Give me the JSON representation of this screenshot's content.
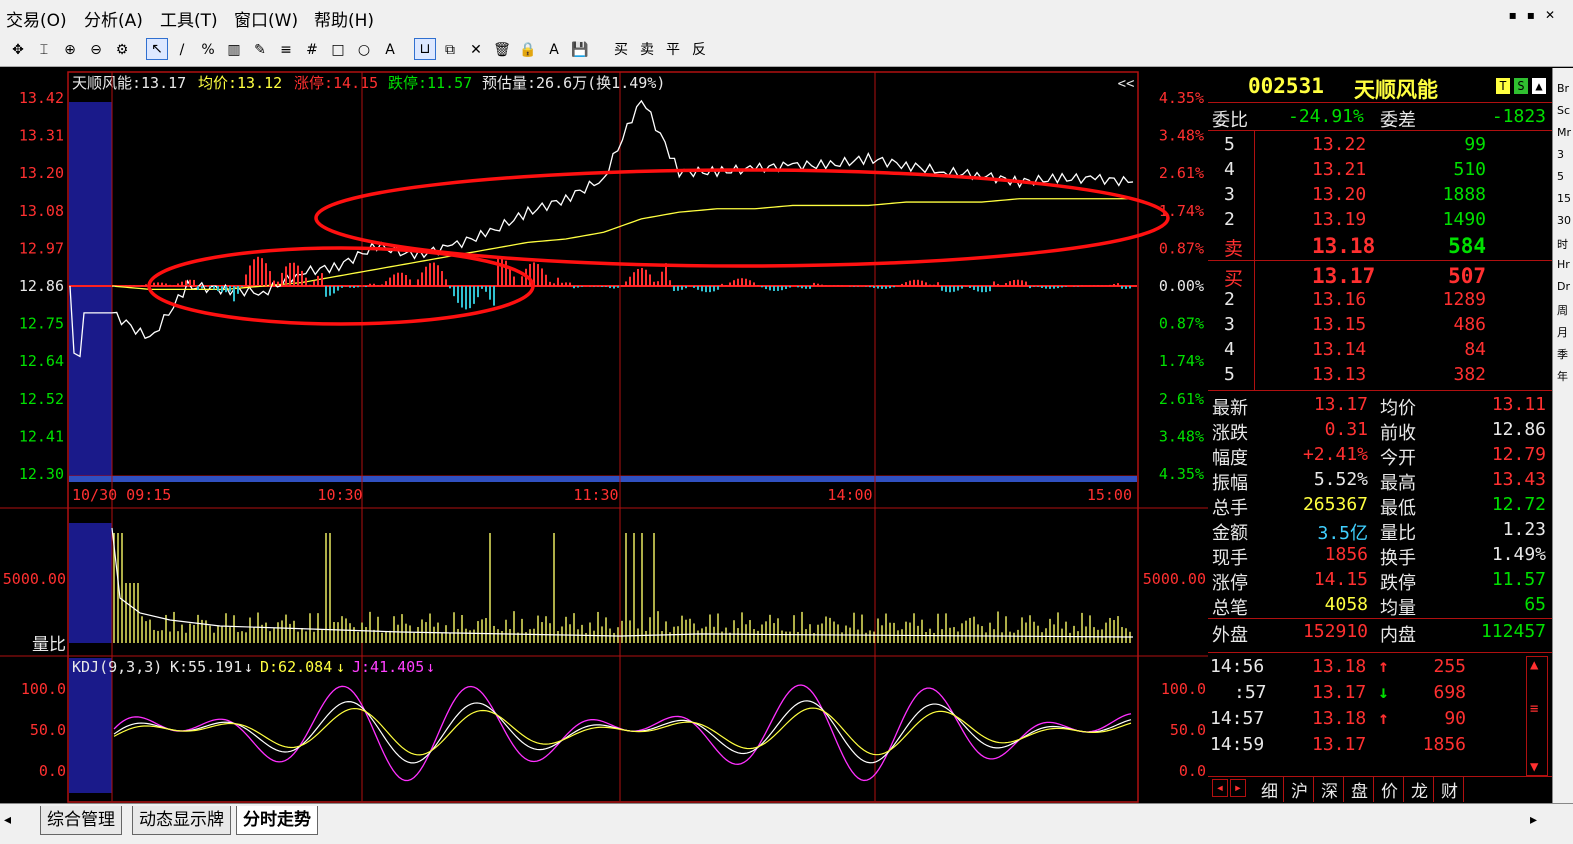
{
  "menu": [
    "交易(O)",
    "分析(A)",
    "工具(T)",
    "窗口(W)",
    "帮助(H)"
  ],
  "window_controls": [
    "▪",
    "▪",
    "✕"
  ],
  "toolbar": {
    "icons": [
      "move-icon",
      "cursor-bar-icon",
      "zoom-in-icon",
      "zoom-out-icon",
      "gear-icon",
      "arrow-icon",
      "line-icon",
      "percent-icon",
      "ruler-icon",
      "pen-icon",
      "grid-icon",
      "hash-icon",
      "rect-icon",
      "circle-icon",
      "text-icon",
      "magnet-icon",
      "copy-icon",
      "close-icon",
      "trash-icon",
      "lock-icon",
      "color-icon",
      "save-icon"
    ],
    "glyphs": [
      "✥",
      "⌶",
      "⊕",
      "⊖",
      "⚙",
      "↖",
      "/",
      "%",
      "▥",
      "✎",
      "≡",
      "#",
      "□",
      "○",
      "A",
      "⊔",
      "⧉",
      "✕",
      "🗑",
      "🔒",
      "A",
      "💾"
    ],
    "trade_buttons": [
      "买",
      "卖",
      "平",
      "反"
    ]
  },
  "chart_header": {
    "name_price": "天顺风能:13.17",
    "avg": "均价:13.12",
    "limit_up": "涨停:14.15",
    "limit_down": "跌停:11.57",
    "est_volume": "预估量:26.6万(换1.49%)",
    "collapse": "<<"
  },
  "axes": {
    "price_left": [
      "13.42",
      "13.31",
      "13.20",
      "13.08",
      "12.97",
      "12.86",
      "12.75",
      "12.64",
      "12.52",
      "12.41",
      "12.30"
    ],
    "pct_right": [
      "4.35%",
      "3.48%",
      "2.61%",
      "1.74%",
      "0.87%",
      "0.00%",
      "0.87%",
      "1.74%",
      "2.61%",
      "3.48%",
      "4.35%"
    ],
    "time_labels": [
      "10/30 09:15",
      "10:30",
      "11:30",
      "14:00",
      "15:00"
    ],
    "vol_left": "5000.00",
    "vol_right": "5000.00",
    "vol_label": "量比",
    "kdj_left": [
      "100.0",
      "50.0",
      "0.0"
    ],
    "kdj_right": [
      "100.0",
      "50.0",
      "0.0"
    ]
  },
  "kdj": {
    "title": "KDJ(9,3,3)",
    "k": "K:55.191",
    "d": "D:62.084",
    "j": "J:41.405",
    "arrow": "↓"
  },
  "colors": {
    "price_line": "#ffffff",
    "avg_line": "#ffff40",
    "grid": "#b01010",
    "up": "#ff3030",
    "down": "#00e000",
    "k_line": "#ffffff",
    "d_line": "#ffff40",
    "j_line": "#ff30ff"
  },
  "chart_data": {
    "type": "line",
    "x": [
      "09:15",
      "09:25",
      "09:30",
      "09:40",
      "09:50",
      "10:00",
      "10:10",
      "10:20",
      "10:30",
      "10:40",
      "10:50",
      "11:00",
      "11:10",
      "11:20",
      "11:30",
      "13:00",
      "13:10",
      "13:20",
      "13:30",
      "13:40",
      "13:50",
      "14:00",
      "14:10",
      "14:20",
      "14:30",
      "14:40",
      "14:50",
      "15:00"
    ],
    "series": [
      {
        "values": [
          12.78,
          12.7,
          12.86,
          12.85,
          12.84,
          12.9,
          12.92,
          12.98,
          12.95,
          12.98,
          13.02,
          13.08,
          13.12,
          13.18,
          13.42,
          13.2,
          13.2,
          13.21,
          13.22,
          13.22,
          13.24,
          13.22,
          13.2,
          13.19,
          13.17,
          13.18,
          13.18,
          13.17
        ]
      },
      {
        "values": [
          12.86,
          12.85,
          12.85,
          12.85,
          12.86,
          12.87,
          12.89,
          12.91,
          12.93,
          12.95,
          12.97,
          12.99,
          13.0,
          13.02,
          13.06,
          13.08,
          13.09,
          13.09,
          13.1,
          13.1,
          13.1,
          13.11,
          13.11,
          13.11,
          13.12,
          13.12,
          13.12,
          13.12
        ]
      }
    ],
    "ylim": [
      12.3,
      13.42
    ]
  },
  "quote": {
    "code": "002531",
    "name": "天顺风能",
    "wei_bi_label": "委比",
    "wei_bi": "-24.91%",
    "wei_cha_label": "委差",
    "wei_cha": "-1823",
    "sell": [
      {
        "lvl": "5",
        "price": "13.22",
        "vol": "99"
      },
      {
        "lvl": "4",
        "price": "13.21",
        "vol": "510"
      },
      {
        "lvl": "3",
        "price": "13.20",
        "vol": "1888"
      },
      {
        "lvl": "2",
        "price": "13.19",
        "vol": "1490"
      },
      {
        "lvl": "卖",
        "price": "13.18",
        "vol": "584"
      }
    ],
    "buy": [
      {
        "lvl": "买",
        "price": "13.17",
        "vol": "507"
      },
      {
        "lvl": "2",
        "price": "13.16",
        "vol": "1289"
      },
      {
        "lvl": "3",
        "price": "13.15",
        "vol": "486"
      },
      {
        "lvl": "4",
        "price": "13.14",
        "vol": "84"
      },
      {
        "lvl": "5",
        "price": "13.13",
        "vol": "382"
      }
    ],
    "stats": [
      {
        "l1": "最新",
        "v1": "13.17",
        "l2": "均价",
        "v2": "13.11"
      },
      {
        "l1": "涨跌",
        "v1": "0.31",
        "l2": "前收",
        "v2": "12.86"
      },
      {
        "l1": "幅度",
        "v1": "+2.41%",
        "l2": "今开",
        "v2": "12.79"
      },
      {
        "l1": "振幅",
        "v1": "5.52%",
        "l2": "最高",
        "v2": "13.43"
      },
      {
        "l1": "总手",
        "v1": "265367",
        "l2": "最低",
        "v2": "12.72"
      },
      {
        "l1": "金额",
        "v1": "3.5亿",
        "l2": "量比",
        "v2": "1.23"
      },
      {
        "l1": "现手",
        "v1": "1856",
        "l2": "换手",
        "v2": "1.49%"
      },
      {
        "l1": "涨停",
        "v1": "14.15",
        "l2": "跌停",
        "v2": "11.57"
      },
      {
        "l1": "总笔",
        "v1": "4058",
        "l2": "均量",
        "v2": "65"
      }
    ],
    "outer_label": "外盘",
    "outer": "152910",
    "inner_label": "内盘",
    "inner": "112457",
    "ticks": [
      {
        "t": "14:56",
        "p": "13.18",
        "d": "↑",
        "v": "255"
      },
      {
        "t": ":57",
        "p": "13.17",
        "d": "↓",
        "v": "698"
      },
      {
        "t": "14:57",
        "p": "13.18",
        "d": "↑",
        "v": "90"
      },
      {
        "t": "14:59",
        "p": "13.17",
        "d": "",
        "v": "1856"
      }
    ],
    "bottom_tabs": [
      "细",
      "沪",
      "深",
      "盘",
      "价",
      "龙",
      "财"
    ]
  },
  "sidebar_items": [
    "Br",
    "Sc",
    "Mr",
    "3",
    "5",
    "15",
    "30",
    "时",
    "Hr",
    "Dr",
    "周",
    "月",
    "季",
    "年"
  ],
  "tabs": [
    "综合管理",
    "动态显示牌",
    "分时走势"
  ]
}
